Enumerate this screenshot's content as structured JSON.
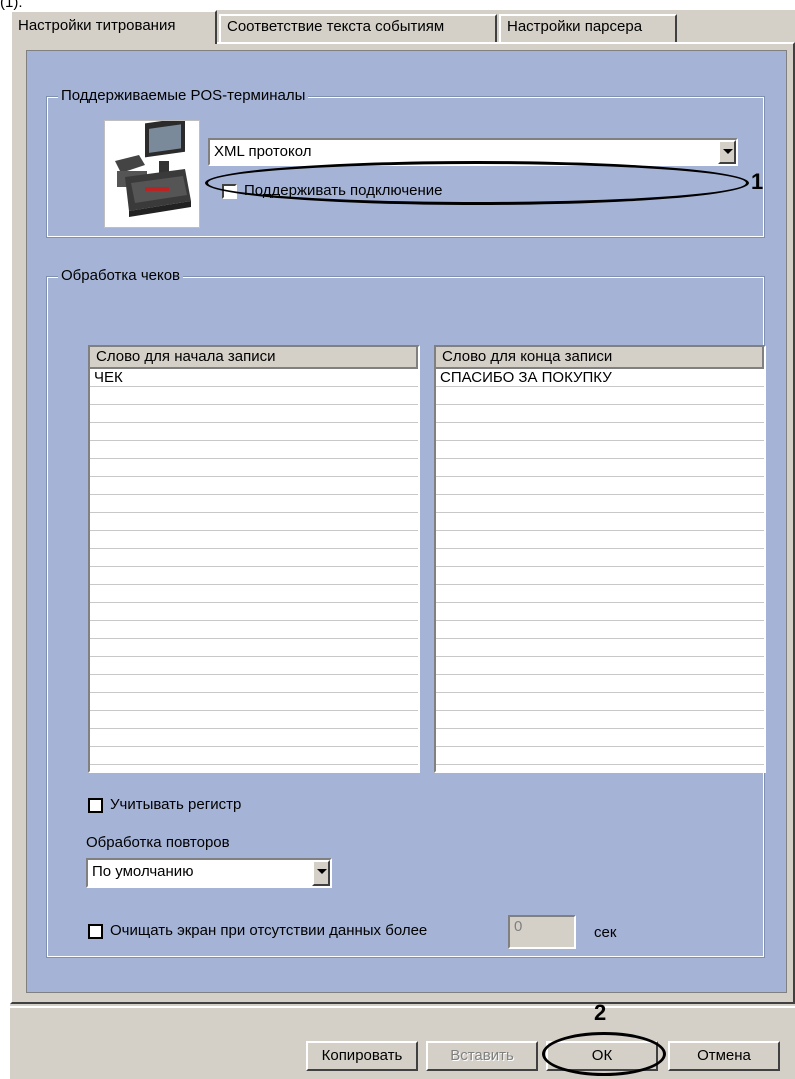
{
  "stray_text": "(1).",
  "tabs": [
    {
      "label": "Настройки титрования",
      "active": true
    },
    {
      "label": "Соответствие текста событиям",
      "active": false
    },
    {
      "label": "Настройки парсера",
      "active": false
    }
  ],
  "pos_group": {
    "legend": "Поддерживаемые POS-терминалы",
    "protocol_value": "XML протокол",
    "support_connection_label": "Поддерживать подключение",
    "support_connection_checked": false
  },
  "checks_group": {
    "legend": "Обработка чеков",
    "start_list": {
      "header": "Слово для начала записи",
      "rows": [
        "ЧЕК"
      ]
    },
    "end_list": {
      "header": "Слово для конца записи",
      "rows": [
        "СПАСИБО ЗА ПОКУПКУ"
      ]
    },
    "case_sensitive_label": "Учитывать регистр",
    "case_sensitive_checked": false,
    "repeat_label": "Обработка повторов",
    "repeat_value": "По умолчанию",
    "clear_screen_label": "Очищать экран при отсутствии данных более",
    "clear_screen_checked": false,
    "clear_screen_value": "0",
    "clear_screen_unit": "сек"
  },
  "markers": {
    "one": "1",
    "two": "2"
  },
  "buttons": {
    "copy": "Копировать",
    "paste": "Вставить",
    "ok": "ОК",
    "cancel": "Отмена"
  },
  "colors": {
    "panel_bg": "#a5b4d6",
    "chrome": "#d4d0c8"
  }
}
